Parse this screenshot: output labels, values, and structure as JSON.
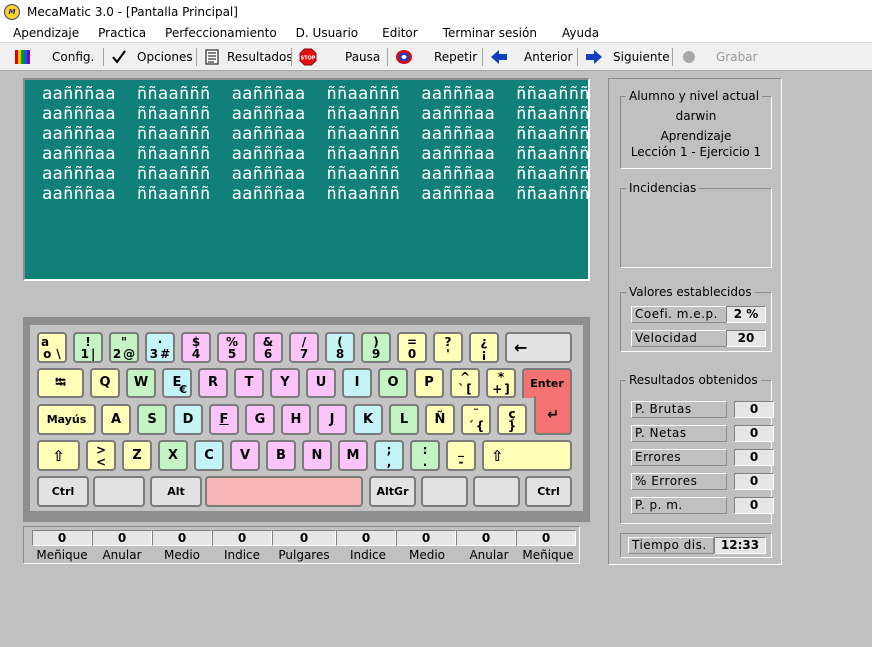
{
  "window": {
    "title": "MecaMatic 3.0  - [Pantalla Principal]",
    "icon": "mecamatic-logo-icon"
  },
  "menu": [
    "Apendizaje",
    "Practica",
    "Perfeccionamiento",
    "D. Usuario",
    "Editor",
    "Terminar sesión",
    "Ayuda"
  ],
  "toolbar": {
    "config": "Config.",
    "opciones": "Opciones",
    "resultados": "Resultados",
    "pausa": "Pausa",
    "repetir": "Repetir",
    "anterior": "Anterior",
    "siguiente": "Siguiente",
    "grabar": "Grabar",
    "stop_label": "STOP"
  },
  "exercise_text": [
    "aañññaa  ññaañññ  aañññaa  ññaañññ  aañññaa  ññaañññ",
    "aañññaa  ññaañññ  aañññaa  ññaañññ  aañññaa  ññaañññ",
    "aañññaa  ññaañññ  aañññaa  ññaañññ  aañññaa  ññaañññ",
    "aañññaa  ññaañññ  aañññaa  ññaañññ  aañññaa  ññaañññ",
    "aañññaa  ññaañññ  aañññaa  ññaañññ  aañññaa  ññaañññ",
    "aañññaa  ññaañññ  aañññaa  ññaañññ  aañññaa  ññaañññ"
  ],
  "keyboard": {
    "row1": [
      {
        "t": "a",
        "l": "o",
        "r": "\\"
      },
      {
        "t": "!",
        "l": "1",
        "r": "|"
      },
      {
        "t": "\"",
        "l": "2",
        "r": "@"
      },
      {
        "t": "·",
        "l": "3",
        "r": "#"
      },
      {
        "t": "$",
        "l": "4",
        "r": ""
      },
      {
        "t": "%",
        "l": "5",
        "r": ""
      },
      {
        "t": "&",
        "l": "6",
        "r": ""
      },
      {
        "t": "/",
        "l": "7",
        "r": ""
      },
      {
        "t": "(",
        "l": "8",
        "r": ""
      },
      {
        "t": ")",
        "l": "9",
        "r": ""
      },
      {
        "t": "=",
        "l": "0",
        "r": ""
      },
      {
        "t": "?",
        "l": "'",
        "r": ""
      },
      {
        "t": "¿",
        "l": "¡",
        "r": ""
      }
    ],
    "backspace": "←",
    "tab": "⭾",
    "row2": [
      "Q",
      "W",
      "E",
      "R",
      "T",
      "Y",
      "U",
      "I",
      "O",
      "P"
    ],
    "euro": "€",
    "row2_extra": [
      {
        "t": "^",
        "l": "`",
        "r": "["
      },
      {
        "t": "*",
        "l": "+",
        "r": "]"
      }
    ],
    "enter": "Enter",
    "enter_arrow": "↵",
    "caps": "Mayús",
    "row3": [
      "A",
      "S",
      "D",
      "F",
      "G",
      "H",
      "J",
      "K",
      "L",
      "Ñ"
    ],
    "row3_extra": [
      {
        "t": "¨",
        "l": "´",
        "r": "{"
      },
      {
        "t": "ç",
        "l": "",
        "r": "}"
      }
    ],
    "shift": "⇧",
    "lt_key": {
      "t": ">",
      "l": "<",
      "r": ""
    },
    "row4": [
      "Z",
      "X",
      "C",
      "V",
      "B",
      "N",
      "M"
    ],
    "row4_extra": [
      {
        "t": ";",
        "l": ",",
        "r": ""
      },
      {
        "t": ":",
        "l": ".",
        "r": ""
      },
      {
        "t": "_",
        "l": "-",
        "r": ""
      }
    ],
    "ctrl": "Ctrl",
    "alt": "Alt",
    "altgr": "AltGr"
  },
  "counters": [
    {
      "label": "Meñique",
      "value": "0"
    },
    {
      "label": "Anular",
      "value": "0"
    },
    {
      "label": "Medio",
      "value": "0"
    },
    {
      "label": "Indice",
      "value": "0"
    },
    {
      "label": "Pulgares",
      "value": "0"
    },
    {
      "label": "Indice",
      "value": "0"
    },
    {
      "label": "Medio",
      "value": "0"
    },
    {
      "label": "Anular",
      "value": "0"
    },
    {
      "label": "Meñique",
      "value": "0"
    }
  ],
  "side": {
    "student_title": "Alumno y nivel actual",
    "student_name": "darwin",
    "mode": "Aprendizaje",
    "lesson": "Lección 1 - Ejercicio  1",
    "incidents_title": "Incidencias",
    "settings_title": "Valores establecidos",
    "settings": [
      {
        "label": "Coefi. m.e.p.",
        "value": "2 %"
      },
      {
        "label": "Velocidad",
        "value": "20"
      }
    ],
    "results_title": "Resultados obtenidos",
    "results": [
      {
        "label": "P. Brutas",
        "value": "0"
      },
      {
        "label": "P. Netas",
        "value": "0"
      },
      {
        "label": "Errores",
        "value": "0"
      },
      {
        "label": "%  Errores",
        "value": "0"
      },
      {
        "label": "P. p. m.",
        "value": "0"
      }
    ],
    "time_label": "Tiempo dis.",
    "time_value": "12:33"
  },
  "colors": {
    "text_area": "#108078",
    "enter_key": "#f47272",
    "pinky": "#ffffb8",
    "ring": "#c4f3c4",
    "middle": "#c4f3f8",
    "index": "#fbc4fb",
    "thumb": "#f8b8b8"
  }
}
